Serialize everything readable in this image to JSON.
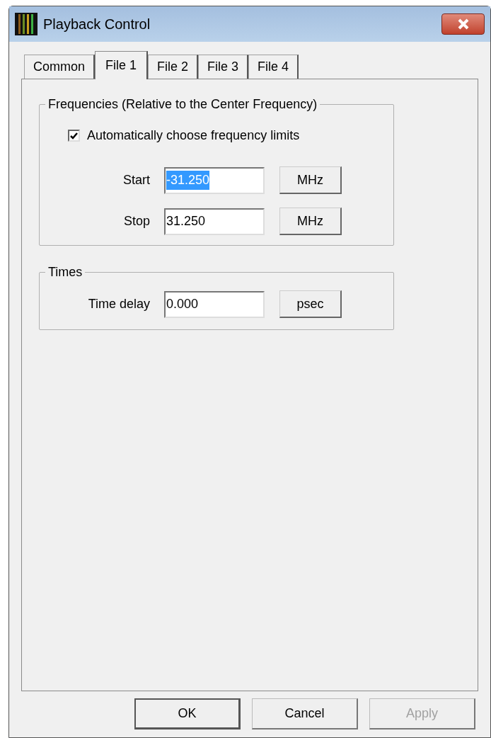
{
  "window": {
    "title": "Playback Control"
  },
  "tabs": [
    {
      "label": "Common",
      "selected": false
    },
    {
      "label": "File 1",
      "selected": true
    },
    {
      "label": "File 2",
      "selected": false
    },
    {
      "label": "File 3",
      "selected": false
    },
    {
      "label": "File 4",
      "selected": false
    }
  ],
  "frequencies": {
    "title": "Frequencies (Relative to the Center Frequency)",
    "auto_limits": {
      "label": "Automatically choose frequency limits",
      "checked": true
    },
    "fields": [
      {
        "label": "Start",
        "value": "-31.250",
        "text_selected": true,
        "unit": "MHz"
      },
      {
        "label": "Stop",
        "value": "31.250",
        "text_selected": false,
        "unit": "MHz"
      }
    ]
  },
  "times": {
    "title": "Times",
    "fields": [
      {
        "label": "Time delay",
        "value": "0.000",
        "text_selected": false,
        "unit": "psec"
      }
    ]
  },
  "buttons": [
    {
      "label": "OK",
      "default": true,
      "disabled": false
    },
    {
      "label": "Cancel",
      "default": false,
      "disabled": false
    },
    {
      "label": "Apply",
      "default": false,
      "disabled": true
    }
  ]
}
